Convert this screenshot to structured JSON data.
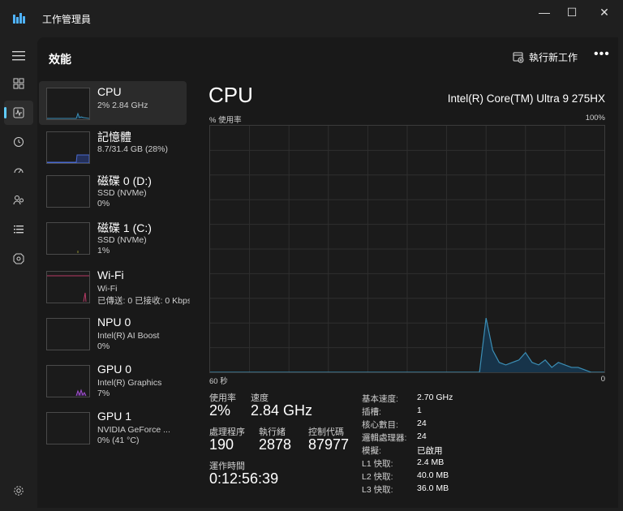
{
  "window": {
    "title": "工作管理員",
    "minimize": "—",
    "maximize": "☐",
    "close": "✕"
  },
  "nav": {
    "items": [
      "menu-icon",
      "processes-icon",
      "performance-icon",
      "app-history-icon",
      "startup-icon",
      "users-icon",
      "details-icon",
      "services-icon",
      "settings-icon"
    ]
  },
  "header": {
    "title": "效能",
    "run_new_task": "執行新工作",
    "more": "•••"
  },
  "list": [
    {
      "title": "CPU",
      "sub1": "2%  2.84 GHz",
      "sub2": ""
    },
    {
      "title": "記憶體",
      "sub1": "8.7/31.4 GB (28%)",
      "sub2": ""
    },
    {
      "title": "磁碟 0 (D:)",
      "sub1": "SSD (NVMe)",
      "sub2": "0%"
    },
    {
      "title": "磁碟 1 (C:)",
      "sub1": "SSD (NVMe)",
      "sub2": "1%"
    },
    {
      "title": "Wi-Fi",
      "sub1": "Wi-Fi",
      "sub2": "已傳送: 0 已接收: 0 Kbps"
    },
    {
      "title": "NPU 0",
      "sub1": "Intel(R) AI Boost",
      "sub2": "0%"
    },
    {
      "title": "GPU 0",
      "sub1": "Intel(R) Graphics",
      "sub2": "7%"
    },
    {
      "title": "GPU 1",
      "sub1": "NVIDIA GeForce ...",
      "sub2": "0% (41 °C)"
    }
  ],
  "detail": {
    "title": "CPU",
    "model": "Intel(R) Core(TM) Ultra 9 275HX",
    "usage_label": "% 使用率",
    "max_label": "100%",
    "axis_left": "60 秒",
    "axis_right": "0",
    "stats": {
      "utilization_label": "使用率",
      "utilization": "2%",
      "speed_label": "速度",
      "speed": "2.84 GHz",
      "processes_label": "處理程序",
      "processes": "190",
      "threads_label": "執行緒",
      "threads": "2878",
      "handles_label": "控制代碼",
      "handles": "87977",
      "uptime_label": "運作時間",
      "uptime": "0:12:56:39"
    },
    "specs": [
      {
        "key": "基本速度:",
        "value": "2.70 GHz"
      },
      {
        "key": "插槽:",
        "value": "1"
      },
      {
        "key": "核心數目:",
        "value": "24"
      },
      {
        "key": "邏輯處理器:",
        "value": "24"
      },
      {
        "key": "模擬:",
        "value": "已啟用"
      },
      {
        "key": "L1 快取:",
        "value": "2.4 MB"
      },
      {
        "key": "L2 快取:",
        "value": "40.0 MB"
      },
      {
        "key": "L3 快取:",
        "value": "36.0 MB"
      }
    ]
  },
  "chart_data": {
    "type": "area",
    "x": [
      0,
      1,
      2,
      3,
      4,
      5,
      6,
      7,
      8,
      9,
      10,
      11,
      12,
      13,
      14,
      15,
      16,
      17,
      18,
      19,
      20,
      21,
      22,
      23,
      24,
      25,
      26,
      27,
      28,
      29,
      30,
      31,
      32,
      33,
      34,
      35,
      36,
      37,
      38,
      39,
      40,
      41,
      42,
      43,
      44,
      45,
      46,
      47,
      48,
      49,
      50,
      51,
      52,
      53,
      54,
      55,
      56,
      57,
      58,
      59,
      60
    ],
    "values": [
      0,
      0,
      0,
      0,
      0,
      0,
      0,
      0,
      0,
      0,
      0,
      0,
      0,
      0,
      0,
      0,
      0,
      0,
      0,
      0,
      0,
      0,
      0,
      0,
      0,
      0,
      0,
      0,
      0,
      0,
      0,
      0,
      0,
      0,
      0,
      0,
      0,
      0,
      0,
      0,
      0,
      0,
      22,
      9,
      4,
      3,
      4,
      5,
      8,
      4,
      3,
      5,
      2,
      4,
      3,
      2,
      2,
      1,
      0,
      0,
      0
    ],
    "ylim": [
      0,
      100
    ],
    "colors": {
      "line": "#3b8eb5",
      "fill": "#17344a",
      "grid": "#2f2f2f"
    }
  }
}
